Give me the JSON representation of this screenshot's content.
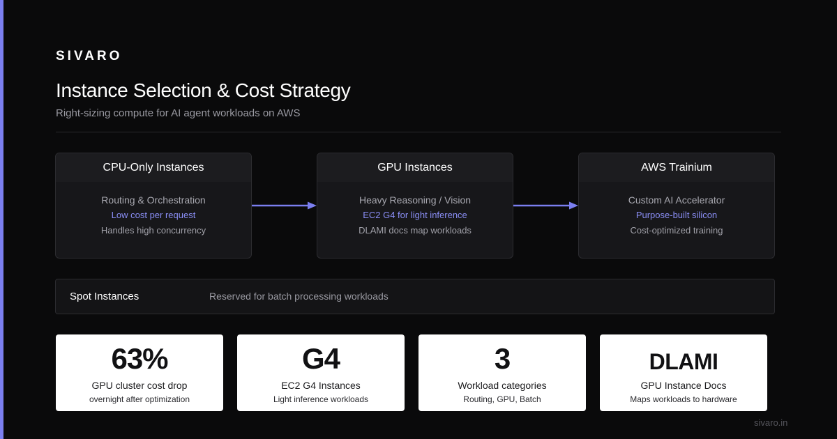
{
  "brand": "SIVARO",
  "title": "Instance Selection & Cost Strategy",
  "subtitle": "Right-sizing compute for AI agent workloads on AWS",
  "flow": [
    {
      "title": "CPU-Only Instances",
      "line1": "Routing & Orchestration",
      "line2": "Low cost per request",
      "line3": "Handles high concurrency"
    },
    {
      "title": "GPU Instances",
      "line1": "Heavy Reasoning / Vision",
      "line2": "EC2 G4 for light inference",
      "line3": "DLAMI docs map workloads"
    },
    {
      "title": "AWS Trainium",
      "line1": "Custom AI Accelerator",
      "line2": "Purpose-built silicon",
      "line3": "Cost-optimized training"
    }
  ],
  "spot": {
    "title": "Spot Instances",
    "description": "Reserved for batch processing workloads"
  },
  "stats": [
    {
      "value": "63%",
      "label": "GPU cluster cost drop",
      "sub": "overnight after optimization"
    },
    {
      "value": "G4",
      "label": "EC2 G4 Instances",
      "sub": "Light inference workloads"
    },
    {
      "value": "3",
      "label": "Workload categories",
      "sub": "Routing, GPU, Batch"
    },
    {
      "value": "DLAMI",
      "label": "GPU Instance Docs",
      "sub": "Maps workloads to hardware"
    }
  ],
  "footer": "sivaro.in",
  "colors": {
    "background": "#0a0a0b",
    "accent": "#7b7ff0",
    "highlight_text": "#8a8ef5",
    "card": "#ffffff"
  },
  "icons": [
    "arrow-right-icon"
  ]
}
